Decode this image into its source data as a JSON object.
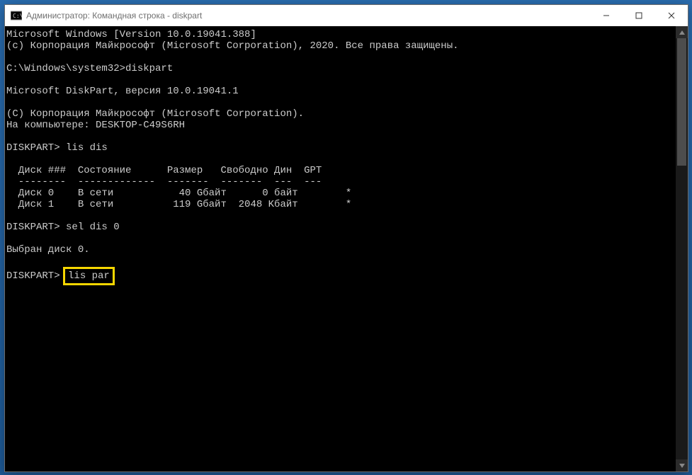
{
  "window": {
    "title": "Администратор: Командная строка - diskpart"
  },
  "icons": {
    "app": "⌨",
    "minimize": "─",
    "maximize": "☐",
    "close": "✕",
    "scroll_up": "▲",
    "scroll_down": "▼"
  },
  "console": {
    "lines": [
      "Microsoft Windows [Version 10.0.19041.388]",
      "(c) Корпорация Майкрософт (Microsoft Corporation), 2020. Все права защищены.",
      "",
      "C:\\Windows\\system32>diskpart",
      "",
      "Microsoft DiskPart, версия 10.0.19041.1",
      "",
      "(C) Корпорация Майкрософт (Microsoft Corporation).",
      "На компьютере: DESKTOP-C49S6RH",
      "",
      "DISKPART> lis dis",
      "",
      "  Диск ###  Состояние      Размер   Свободно Дин  GPT",
      "  --------  -------------  -------  -------  ---  ---",
      "  Диск 0    В сети           40 Gбайт      0 байт        *",
      "  Диск 1    В сети          119 Gбайт  2048 Kбайт        *",
      "",
      "DISKPART> sel dis 0",
      "",
      "Выбран диск 0.",
      ""
    ],
    "last_prompt": "DISKPART> ",
    "highlighted_command": "lis par"
  }
}
